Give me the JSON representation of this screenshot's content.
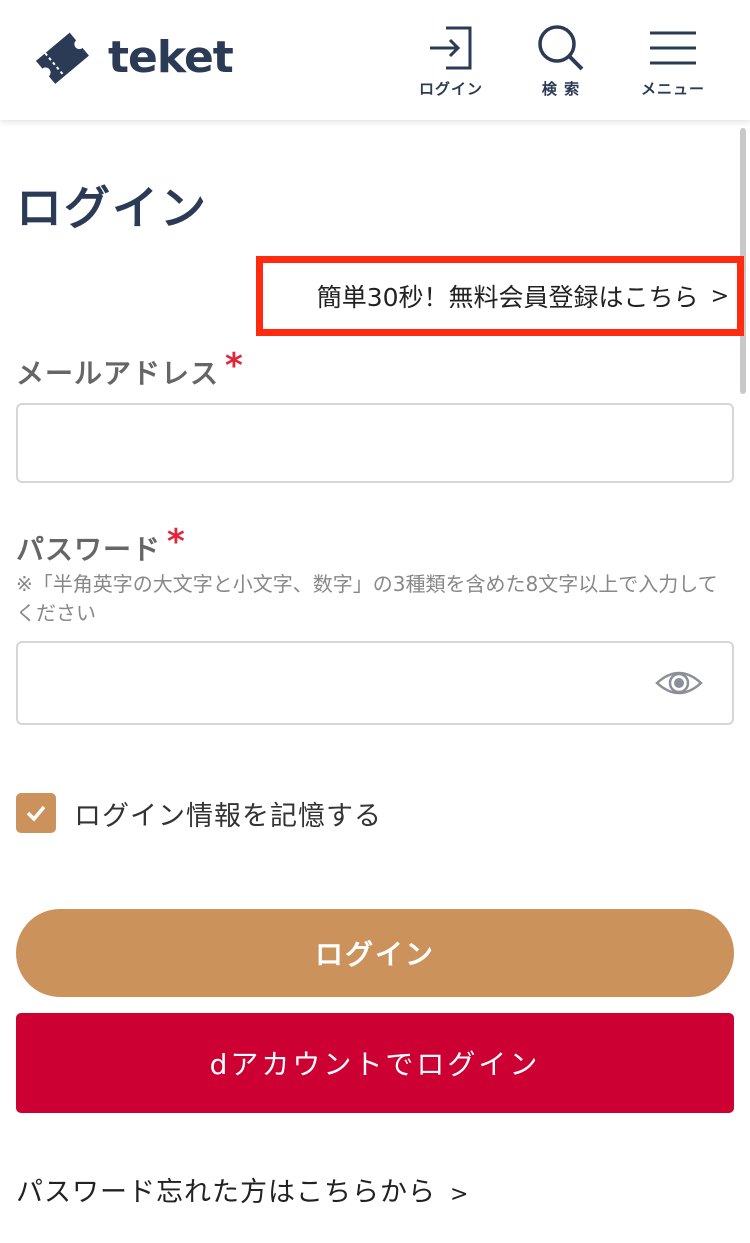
{
  "header": {
    "brand": "teket",
    "nav": [
      {
        "label": "ログイン",
        "icon": "login-icon"
      },
      {
        "label": "検 索",
        "icon": "search-icon"
      },
      {
        "label": "メニュー",
        "icon": "hamburger-menu-icon"
      }
    ]
  },
  "page": {
    "title": "ログイン",
    "register_link": "簡単30秒！無料会員登録はこちら",
    "register_chevron": ">"
  },
  "form": {
    "email": {
      "label": "メールアドレス",
      "required_mark": "*",
      "value": "",
      "placeholder": ""
    },
    "password": {
      "label": "パスワード",
      "required_mark": "*",
      "note": "※「半角英字の大文字と小文字、数字」の3種類を含めた8文字以上で入力してください",
      "value": "",
      "placeholder": ""
    },
    "remember": {
      "label": "ログイン情報を記憶する",
      "checked": true
    },
    "login_button": "ログイン",
    "d_account_button": "dアカウントでログイン",
    "forgot_link": "パスワード忘れた方はこちらから",
    "forgot_chevron": ">"
  },
  "colors": {
    "brand_navy": "#2b3a55",
    "accent_tan": "#cc925c",
    "d_red": "#cc0033",
    "highlight_red": "#ff2a10",
    "required_red": "#e0263a"
  }
}
